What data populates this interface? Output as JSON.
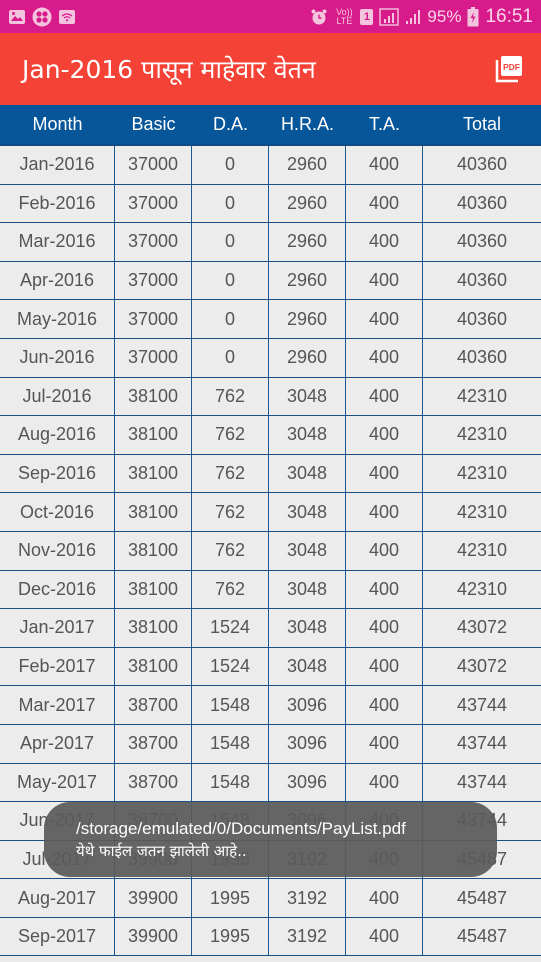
{
  "status_bar": {
    "battery": "95%",
    "time": "16:51",
    "left_icons": [
      "gallery-icon",
      "app-icon",
      "wifi-icon"
    ],
    "right_icons": [
      "alarm-icon",
      "volte-icon",
      "sim-icon",
      "signal-icon",
      "signal-icon",
      "battery-charging-icon"
    ],
    "volte_label": "Vo)) LTE",
    "sim_label": "1"
  },
  "app_bar": {
    "title": "Jan-2016 पासून माहेवार वेतन",
    "action_icon": "pdf-icon",
    "action_label": "PDF"
  },
  "table": {
    "columns": [
      "Month",
      "Basic",
      "D.A.",
      "H.R.A.",
      "T.A.",
      "Total"
    ],
    "rows": [
      [
        "Jan-2016",
        "37000",
        "0",
        "2960",
        "400",
        "40360"
      ],
      [
        "Feb-2016",
        "37000",
        "0",
        "2960",
        "400",
        "40360"
      ],
      [
        "Mar-2016",
        "37000",
        "0",
        "2960",
        "400",
        "40360"
      ],
      [
        "Apr-2016",
        "37000",
        "0",
        "2960",
        "400",
        "40360"
      ],
      [
        "May-2016",
        "37000",
        "0",
        "2960",
        "400",
        "40360"
      ],
      [
        "Jun-2016",
        "37000",
        "0",
        "2960",
        "400",
        "40360"
      ],
      [
        "Jul-2016",
        "38100",
        "762",
        "3048",
        "400",
        "42310"
      ],
      [
        "Aug-2016",
        "38100",
        "762",
        "3048",
        "400",
        "42310"
      ],
      [
        "Sep-2016",
        "38100",
        "762",
        "3048",
        "400",
        "42310"
      ],
      [
        "Oct-2016",
        "38100",
        "762",
        "3048",
        "400",
        "42310"
      ],
      [
        "Nov-2016",
        "38100",
        "762",
        "3048",
        "400",
        "42310"
      ],
      [
        "Dec-2016",
        "38100",
        "762",
        "3048",
        "400",
        "42310"
      ],
      [
        "Jan-2017",
        "38100",
        "1524",
        "3048",
        "400",
        "43072"
      ],
      [
        "Feb-2017",
        "38100",
        "1524",
        "3048",
        "400",
        "43072"
      ],
      [
        "Mar-2017",
        "38700",
        "1548",
        "3096",
        "400",
        "43744"
      ],
      [
        "Apr-2017",
        "38700",
        "1548",
        "3096",
        "400",
        "43744"
      ],
      [
        "May-2017",
        "38700",
        "1548",
        "3096",
        "400",
        "43744"
      ],
      [
        "Jun-2017",
        "38700",
        "1548",
        "3096",
        "400",
        "43744"
      ],
      [
        "Jul-2017",
        "39900",
        "1995",
        "3192",
        "400",
        "45487"
      ],
      [
        "Aug-2017",
        "39900",
        "1995",
        "3192",
        "400",
        "45487"
      ],
      [
        "Sep-2017",
        "39900",
        "1995",
        "3192",
        "400",
        "45487"
      ]
    ]
  },
  "toast": {
    "line1": "/storage/emulated/0/Documents/PayList.pdf",
    "line2": "येथे फाईल जतन झालेली आहे.."
  },
  "colors": {
    "status_bar": "#d81b8a",
    "app_bar": "#f44336",
    "table_header": "#07569a",
    "cell_bg": "#ececec",
    "grid": "#1a5a96"
  }
}
